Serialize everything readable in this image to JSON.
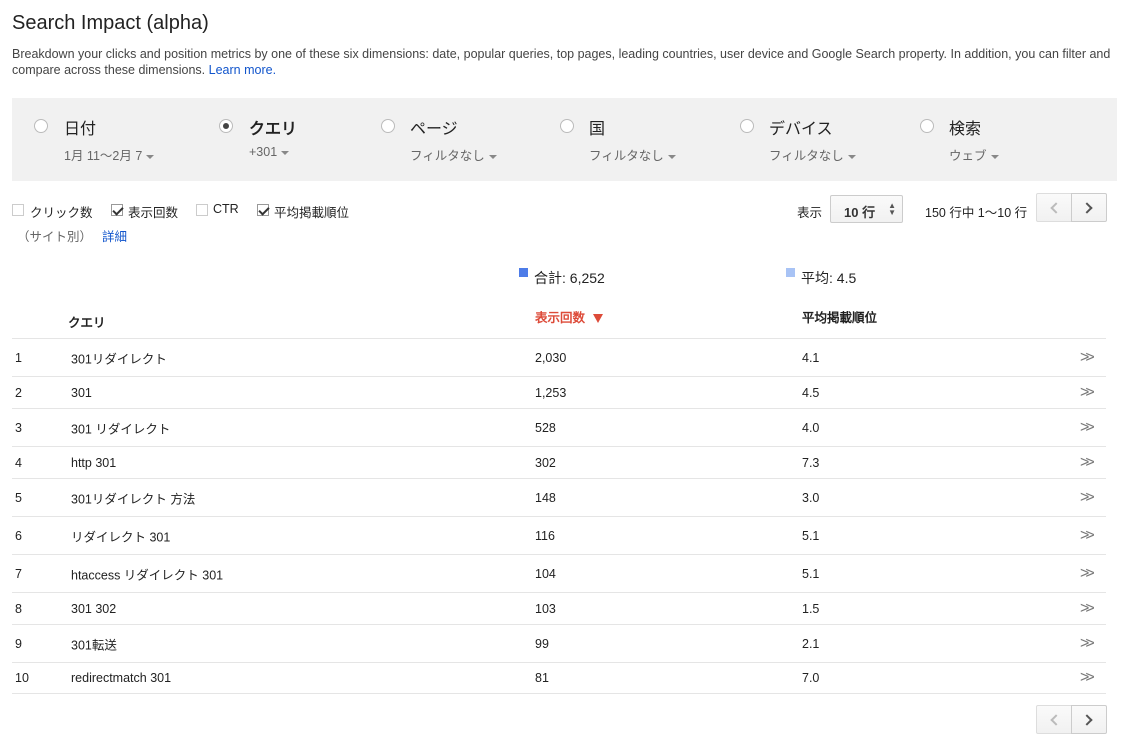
{
  "header": {
    "title": "Search Impact (alpha)",
    "description": "Breakdown your clicks and position metrics by one of these six dimensions: date, popular queries, top pages, leading countries, user device and Google Search property. In addition, you can filter and compare across these dimensions.",
    "learn_more": "Learn more."
  },
  "dimensions": [
    {
      "label": "日付",
      "filter": "1月 11〜2月 7",
      "selected": false
    },
    {
      "label": "クエリ",
      "filter": "+301",
      "selected": true
    },
    {
      "label": "ページ",
      "filter": "フィルタなし",
      "selected": false
    },
    {
      "label": "国",
      "filter": "フィルタなし",
      "selected": false
    },
    {
      "label": "デバイス",
      "filter": "フィルタなし",
      "selected": false
    },
    {
      "label": "検索",
      "filter": "ウェブ",
      "selected": false
    }
  ],
  "metrics": [
    {
      "label": "クリック数",
      "checked": false
    },
    {
      "label": "表示回数",
      "checked": true
    },
    {
      "label": "CTR",
      "checked": false
    },
    {
      "label": "平均掲載順位",
      "checked": true
    }
  ],
  "site_line": {
    "text": "（サイト別）",
    "link": "詳細"
  },
  "paging": {
    "display_label": "表示",
    "rows_value": "10 行",
    "range_text": "150 行中 1〜10 行"
  },
  "summary": {
    "total": "合計: 6,252",
    "average": "平均: 4.5",
    "total_color": "#4d7ce8",
    "average_color": "#a8c3f5"
  },
  "table": {
    "headers": {
      "query": "クエリ",
      "impressions": "表示回数",
      "position": "平均掲載順位"
    },
    "rows": [
      {
        "num": "1",
        "query": "301リダイレクト",
        "impressions": "2,030",
        "position": "4.1"
      },
      {
        "num": "2",
        "query": "301",
        "impressions": "1,253",
        "position": "4.5"
      },
      {
        "num": "3",
        "query": "301 リダイレクト",
        "impressions": "528",
        "position": "4.0"
      },
      {
        "num": "4",
        "query": "http 301",
        "impressions": "302",
        "position": "7.3"
      },
      {
        "num": "5",
        "query": "301リダイレクト 方法",
        "impressions": "148",
        "position": "3.0"
      },
      {
        "num": "6",
        "query": "リダイレクト 301",
        "impressions": "116",
        "position": "5.1"
      },
      {
        "num": "7",
        "query": "htaccess リダイレクト 301",
        "impressions": "104",
        "position": "5.1"
      },
      {
        "num": "8",
        "query": "301 302",
        "impressions": "103",
        "position": "1.5"
      },
      {
        "num": "9",
        "query": "301転送",
        "impressions": "99",
        "position": "2.1"
      },
      {
        "num": "10",
        "query": "redirectmatch 301",
        "impressions": "81",
        "position": "7.0"
      }
    ]
  },
  "icons": {
    "row_action": "double-chevron-right-icon",
    "prev": "chevron-left-icon",
    "next": "chevron-right-icon"
  }
}
